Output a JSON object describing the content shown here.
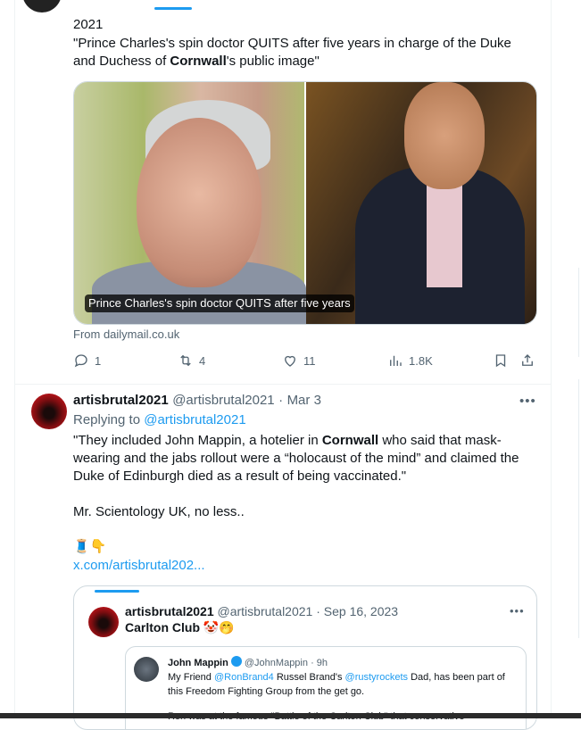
{
  "top_tweet": {
    "year": "2021",
    "headline_part1": "\"Prince Charles's spin doctor QUITS after five years in charge of the Duke and Duchess of ",
    "headline_bold": "Cornwall",
    "headline_part2": "'s public image\"",
    "media_caption": "Prince Charles's spin doctor QUITS after five years",
    "source": "From dailymail.co.uk",
    "replies": "1",
    "retweets": "4",
    "likes": "11",
    "views": "1.8K"
  },
  "reply_tweet": {
    "display_name": "artisbrutal2021",
    "handle": "@artisbrutal2021",
    "separator": "·",
    "date": "Mar 3",
    "more": "•••",
    "replying_label": "Replying to",
    "replying_handle": "@artisbrutal2021",
    "body_part1": "\"They  included John Mappin, a hotelier in ",
    "body_bold": "Cornwall",
    "body_part2": " who said that mask-wearing  and the jabs rollout were a “holocaust of the mind” and claimed the  Duke of Edinburgh died as a result of being vaccinated.\"",
    "body_line2": "Mr. Scientology UK, no less..",
    "emojis": "🧵👇",
    "link": "x.com/artisbrutal202..."
  },
  "quote_tweet": {
    "display_name": "artisbrutal2021",
    "handle": "@artisbrutal2021",
    "separator": "·",
    "date": "Sep 16, 2023",
    "more": "•••",
    "text": "Carlton Club 🤡🤭"
  },
  "inner_quote": {
    "display_name": "John Mappin",
    "handle": "@JohnMappin",
    "separator": "·",
    "date": "9h",
    "text_part1": "My Friend ",
    "mention1": "@RonBrand4",
    "text_part2": "  Russel Brand's ",
    "mention2": "@rustyrockets",
    "text_part3": "  Dad, has been part of this Freedom Fighting Group from the get go.",
    "text_line2": "Ron was at the famous \"Battle of the Carlton Club\" that conservative"
  }
}
